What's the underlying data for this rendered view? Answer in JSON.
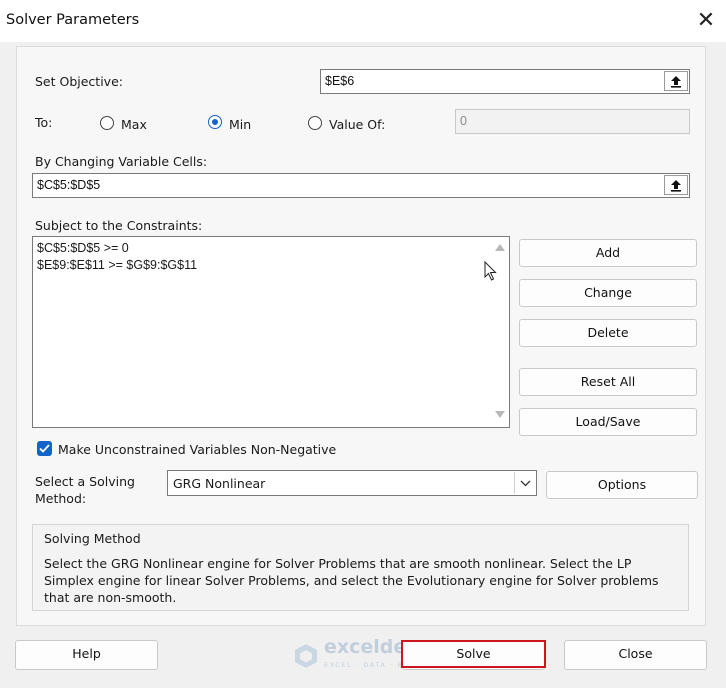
{
  "window": {
    "title": "Solver Parameters",
    "close_glyph": "✕"
  },
  "objective": {
    "label": "Set Objective:",
    "value": "$E$6"
  },
  "to": {
    "label": "To:",
    "options": [
      {
        "label": "Max",
        "selected": false
      },
      {
        "label": "Min",
        "selected": true
      },
      {
        "label": "Value Of:",
        "selected": false
      }
    ],
    "value_of": "0"
  },
  "changing": {
    "label": "By Changing Variable Cells:",
    "value": "$C$5:$D$5"
  },
  "constraints": {
    "label": "Subject to the Constraints:",
    "items": [
      "$C$5:$D$5 >= 0",
      "$E$9:$E$11 >= $G$9:$G$11"
    ]
  },
  "buttons": {
    "add": "Add",
    "change": "Change",
    "delete": "Delete",
    "reset_all": "Reset All",
    "load_save": "Load/Save",
    "options": "Options",
    "help": "Help",
    "solve": "Solve",
    "close": "Close"
  },
  "nonneg": {
    "label": "Make Unconstrained Variables Non-Negative",
    "checked": true
  },
  "method": {
    "label_line1": "Select a Solving",
    "label_line2": "Method:",
    "selected": "GRG Nonlinear"
  },
  "solving_method": {
    "title": "Solving Method",
    "description": "Select the GRG Nonlinear engine for Solver Problems that are smooth nonlinear. Select the LP Simplex engine for linear Solver Problems, and select the Evolutionary engine for Solver problems that are non-smooth."
  },
  "watermark": {
    "brand": "exceldemy",
    "tagline": "EXCEL · DATA · BI"
  },
  "colors": {
    "accent": "#1463c9",
    "highlight": "#d0141e"
  }
}
